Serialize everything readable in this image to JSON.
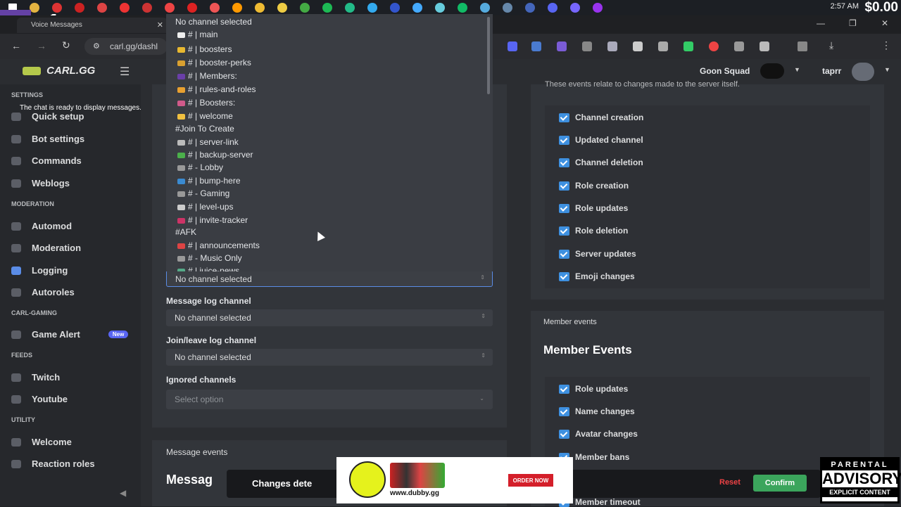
{
  "taskbar": {
    "time": "2:57 AM",
    "balance": "$0.00",
    "stream_count": "1"
  },
  "browser": {
    "tab_title": "Voice Messages",
    "tooltip": "The chat is ready to display messages.",
    "url": "carl.gg/dashl"
  },
  "header": {
    "logo": "CARL.GG",
    "server_name": "Goon Squad",
    "username": "taprr"
  },
  "sidebar": {
    "section_settings": "SETTINGS",
    "section_moderation": "MODERATION",
    "section_carl_gaming": "CARL-GAMING",
    "section_feeds": "FEEDS",
    "section_utility": "UTILITY",
    "items": {
      "quick_setup": "Quick setup",
      "bot_settings": "Bot settings",
      "commands": "Commands",
      "weblogs": "Weblogs",
      "automod": "Automod",
      "moderation": "Moderation",
      "logging": "Logging",
      "autoroles": "Autoroles",
      "game_alert": "Game Alert",
      "game_alert_badge": "New",
      "twitch": "Twitch",
      "youtube": "Youtube",
      "welcome": "Welcome",
      "reaction_roles": "Reaction roles"
    }
  },
  "dropdown": {
    "items": [
      "No channel selected",
      "# | main",
      "# | boosters",
      "# | booster-perks",
      "# | Members:",
      "# | rules-and-roles",
      "# | Boosters:",
      "# | welcome",
      "#Join To Create",
      "# | server-link",
      "# | backup-server",
      "# - Lobby",
      "# | bump-here",
      "# - Gaming",
      "# | level-ups",
      "# | invite-tracker",
      "#AFK",
      "# | announcements",
      "# - Music Only",
      "# | juice-news"
    ]
  },
  "form": {
    "selected_channel": "No channel selected",
    "message_log_label": "Message log channel",
    "message_log_value": "No channel selected",
    "join_leave_label": "Join/leave log channel",
    "join_leave_value": "No channel selected",
    "ignored_label": "Ignored channels",
    "ignored_placeholder": "Select option",
    "message_events_header": "Message events",
    "message_events_title": "Messag"
  },
  "server_events": {
    "description": "These events relate to changes made to the server itself.",
    "items": [
      "Channel creation",
      "Updated channel",
      "Channel deletion",
      "Role creation",
      "Role updates",
      "Role deletion",
      "Server updates",
      "Emoji changes"
    ]
  },
  "member_events": {
    "header": "Member events",
    "title": "Member Events",
    "items": [
      "Role updates",
      "Name changes",
      "Avatar changes",
      "Member bans",
      "Member timeout"
    ]
  },
  "savebar": {
    "text": "Changes dete",
    "reset": "Reset",
    "confirm": "Confirm"
  },
  "ad": {
    "order": "ORDER NOW",
    "site": "www.dubby.gg"
  },
  "advisory": {
    "line1": "PARENTAL",
    "line2": "ADVISORY",
    "line3": "EXPLICIT CONTENT"
  },
  "colors": {
    "accent": "#3e90e0",
    "confirm": "#3ba55c",
    "reset": "#ed4245"
  }
}
